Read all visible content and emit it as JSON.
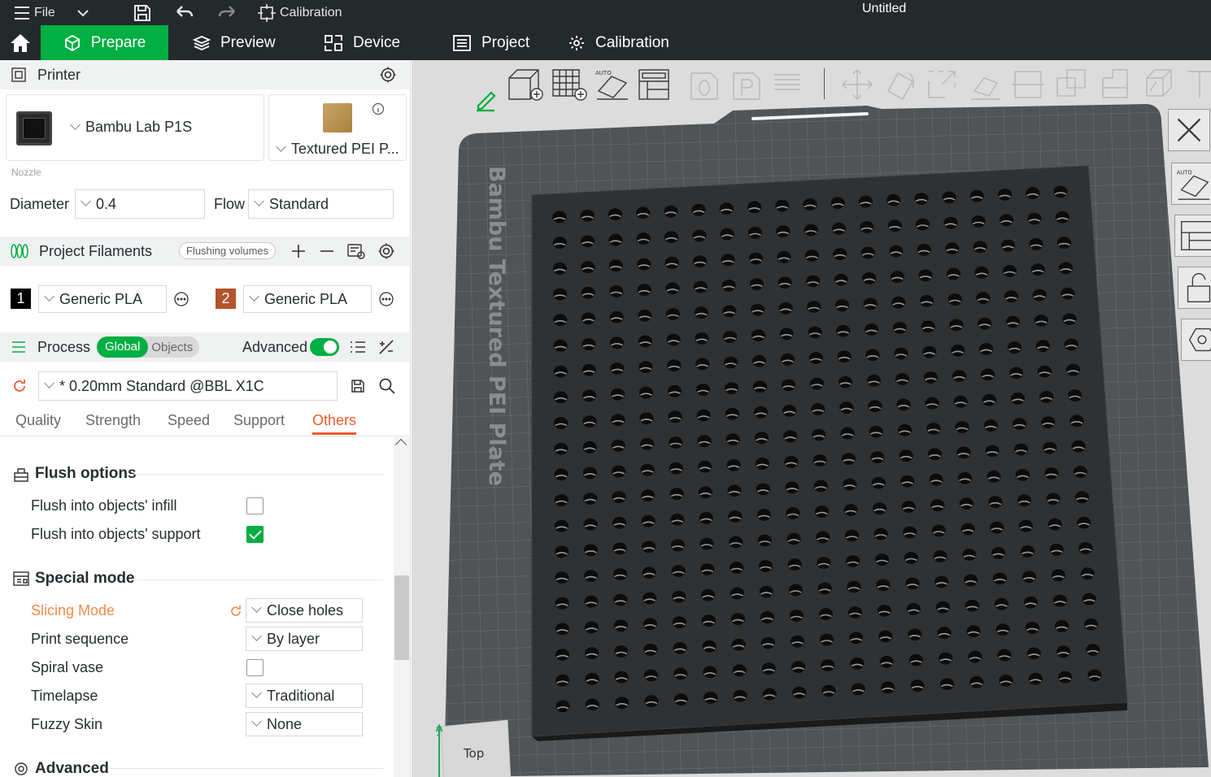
{
  "titlebar": {
    "file_label": "File",
    "calibration_label": "Calibration",
    "window_title": "Untitled"
  },
  "tabs": [
    {
      "label": "Prepare",
      "active": true
    },
    {
      "label": "Preview"
    },
    {
      "label": "Device"
    },
    {
      "label": "Project"
    },
    {
      "label": "Calibration"
    }
  ],
  "printer": {
    "section_title": "Printer",
    "printer_name": "Bambu Lab P1S",
    "plate_name": "Textured PEI P...",
    "nozzle_label": "Nozzle",
    "diameter_label": "Diameter",
    "diameter_value": "0.4",
    "flow_label": "Flow",
    "flow_value": "Standard"
  },
  "filaments": {
    "section_title": "Project Filaments",
    "flushing_label": "Flushing volumes",
    "items": [
      {
        "num": "1",
        "name": "Generic PLA",
        "color": "#000000"
      },
      {
        "num": "2",
        "name": "Generic PLA",
        "color": "#b5532c"
      }
    ]
  },
  "process": {
    "section_title": "Process",
    "global_label": "Global",
    "objects_label": "Objects",
    "advanced_label": "Advanced",
    "advanced_on": true,
    "profile": "* 0.20mm Standard @BBL X1C",
    "subtabs": [
      "Quality",
      "Strength",
      "Speed",
      "Support",
      "Others"
    ],
    "active_subtab": "Others"
  },
  "flush_options": {
    "title": "Flush options",
    "items": [
      {
        "label": "Flush into objects' infill",
        "checked": false
      },
      {
        "label": "Flush into objects' support",
        "checked": true
      }
    ]
  },
  "special_mode": {
    "title": "Special mode",
    "slicing_mode_label": "Slicing Mode",
    "slicing_mode_value": "Close holes",
    "print_sequence_label": "Print sequence",
    "print_sequence_value": "By layer",
    "spiral_vase_label": "Spiral vase",
    "spiral_vase_checked": false,
    "timelapse_label": "Timelapse",
    "timelapse_value": "Traditional",
    "fuzzy_skin_label": "Fuzzy Skin",
    "fuzzy_skin_value": "None"
  },
  "advanced_group": {
    "title": "Advanced"
  },
  "viewport": {
    "plate_label": "Bambu Textured PEI Plate",
    "view_cube_label": "Top",
    "axis_label": "y",
    "grid": {
      "rows": 20,
      "cols": 19
    }
  },
  "colors": {
    "accent": "#00ae42",
    "modified": "#f05a28",
    "dark_bar": "#24292b"
  }
}
